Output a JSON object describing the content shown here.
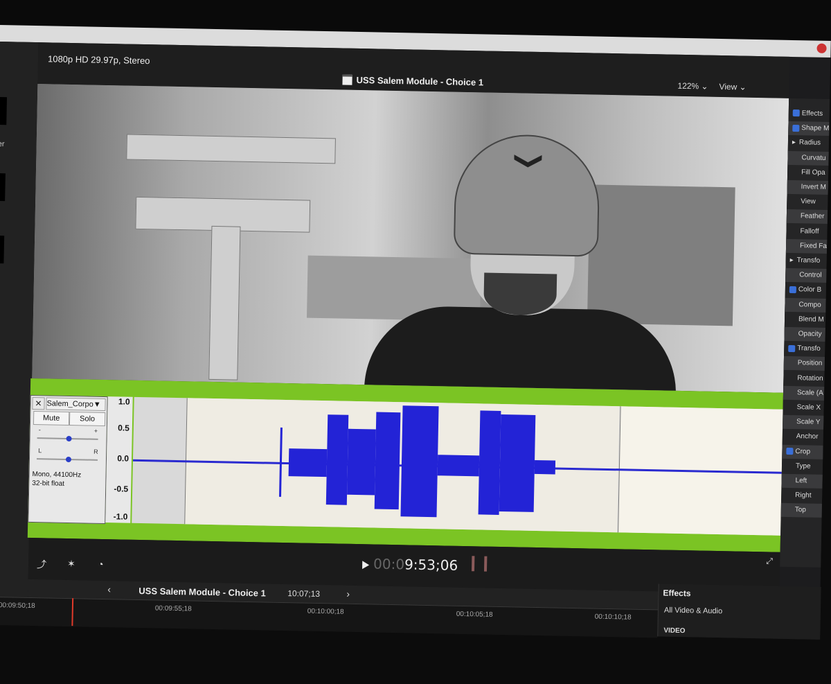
{
  "viewer": {
    "format": "1080p HD 29.97p, Stereo",
    "project_title": "USS Salem Module - Choice 1",
    "zoom": "122% ⌄",
    "view": "View ⌄"
  },
  "left_rail": {
    "partial_text": "er"
  },
  "audacity": {
    "track_name": "Salem_Corpo▼",
    "close": "✕",
    "mute": "Mute",
    "solo": "Solo",
    "gain_minus": "-",
    "gain_plus": "+",
    "pan_l": "L",
    "pan_r": "R",
    "info_line1": "Mono, 44100Hz",
    "info_line2": "32-bit float",
    "scale": [
      "1.0",
      "0.5",
      "0.0",
      "-0.5",
      "-1.0"
    ]
  },
  "playback": {
    "timecode_dim": "00:0",
    "timecode_main": "9:53;06"
  },
  "timeline": {
    "title": "USS Salem Module - Choice 1",
    "duration": "10:07;13",
    "nav_prev": "‹",
    "nav_next": "›",
    "ruler": [
      "00:09:50;18",
      "00:09:55;18",
      "00:10:00;18",
      "00:10:05;18",
      "00:10:10;18"
    ]
  },
  "inspector": {
    "items": [
      {
        "label": "Effects",
        "check": true
      },
      {
        "label": "Shape M",
        "check": true
      },
      {
        "label": "Radius",
        "arrow": true
      },
      {
        "label": "Curvatu"
      },
      {
        "label": "Fill Opa"
      },
      {
        "label": "Invert M"
      },
      {
        "label": "View"
      },
      {
        "label": "Feather"
      },
      {
        "label": "Falloff"
      },
      {
        "label": "Fixed Fa"
      },
      {
        "label": "Transfo",
        "arrow": true
      },
      {
        "label": "Control"
      },
      {
        "label": "Color B",
        "check": true
      },
      {
        "label": "Compo"
      },
      {
        "label": "Blend M"
      },
      {
        "label": "Opacity"
      },
      {
        "label": "Transfo",
        "check": true
      },
      {
        "label": "Position"
      },
      {
        "label": "Rotation"
      },
      {
        "label": "Scale (A"
      },
      {
        "label": "Scale X"
      },
      {
        "label": "Scale Y"
      },
      {
        "label": "Anchor"
      },
      {
        "label": "Crop",
        "check": true
      },
      {
        "label": "Type"
      },
      {
        "label": "Left"
      },
      {
        "label": "Right"
      },
      {
        "label": "Top"
      }
    ]
  },
  "effects_browser": {
    "title": "Effects",
    "item": "All Video & Audio",
    "section": "VIDEO"
  },
  "colors": {
    "waveform": "#2323d6",
    "audacity_frame": "#7bc424",
    "playhead": "#e03a2a",
    "checkbox": "#3a6fd8"
  }
}
